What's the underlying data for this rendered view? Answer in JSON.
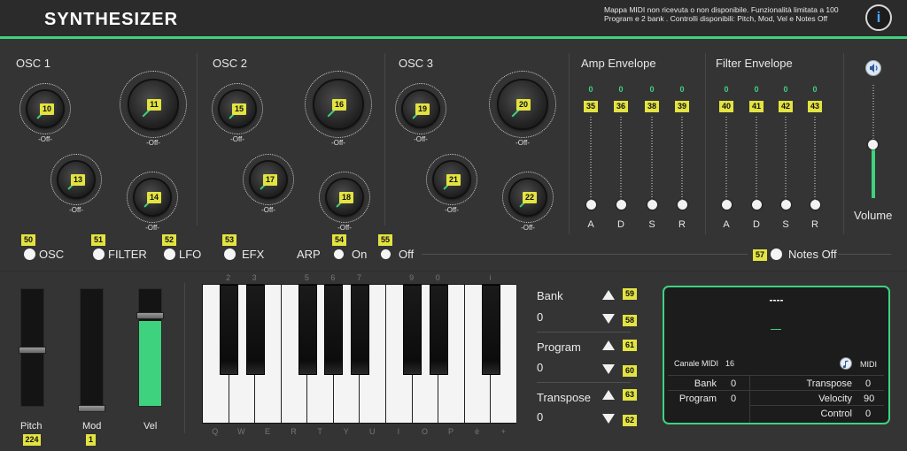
{
  "header": {
    "title": "SYNTHESIZER",
    "notice": "Mappa MIDI non ricevuta  o non disponibile. Funzionalità limitata a 100 Program e 2 bank . Controlli disponibili: Pitch, Mod, Vel e Notes Off",
    "info_label": "i"
  },
  "sections": {
    "osc1": "OSC 1",
    "osc2": "OSC 2",
    "osc3": "OSC 3",
    "amp": "Amp Envelope",
    "filter": "Filter Envelope"
  },
  "knobs": {
    "k10": "10",
    "k11": "11",
    "k13": "13",
    "k14": "14",
    "k15": "15",
    "k16": "16",
    "k17": "17",
    "k18": "18",
    "k19": "19",
    "k20": "20",
    "k21": "21",
    "k22": "22",
    "off": "-Off-"
  },
  "amp_env": {
    "values": [
      "0",
      "0",
      "0",
      "0"
    ],
    "cc": [
      "35",
      "36",
      "38",
      "39"
    ],
    "letters": [
      "A",
      "D",
      "S",
      "R"
    ]
  },
  "filter_env": {
    "values": [
      "0",
      "0",
      "0",
      "0"
    ],
    "cc": [
      "40",
      "41",
      "42",
      "43"
    ],
    "letters": [
      "A",
      "D",
      "S",
      "R"
    ]
  },
  "volume": {
    "label": "Volume",
    "level": 0.47
  },
  "toggles": {
    "cc50": "50",
    "cc51": "51",
    "cc52": "52",
    "cc53": "53",
    "cc54": "54",
    "cc55": "55",
    "cc57": "57",
    "osc": "OSC",
    "filter": "FILTER",
    "lfo": "LFO",
    "efx": "EFX",
    "arp": "ARP",
    "on": "On",
    "off": "Off",
    "notes_off": "Notes Off"
  },
  "wheels": {
    "pitch": "Pitch",
    "mod": "Mod",
    "vel": "Vel",
    "pitch_value": "224",
    "mod_value": "1",
    "vel_level": 0.73
  },
  "keyboard": {
    "top": [
      "2",
      "3",
      "5",
      "6",
      "7",
      "9",
      "0",
      "i"
    ],
    "bottom": [
      "Q",
      "W",
      "E",
      "R",
      "T",
      "Y",
      "U",
      "I",
      "O",
      "P",
      "è",
      "+"
    ]
  },
  "program": {
    "bank_label": "Bank",
    "bank_value": "0",
    "bank_up": "59",
    "bank_down": "58",
    "program_label": "Program",
    "program_value": "0",
    "program_up": "61",
    "program_down": "60",
    "transpose_label": "Transpose",
    "transpose_value": "0",
    "transpose_up": "63",
    "transpose_down": "62"
  },
  "midi": {
    "display": "----",
    "dash": "—",
    "canale_label": "Canale MIDI",
    "canale_value": "16",
    "midi_label": "MIDI",
    "bank_label": "Bank",
    "bank_value": "0",
    "program_label": "Program",
    "program_value": "0",
    "transpose_label": "Transpose",
    "transpose_value": "0",
    "velocity_label": "Velocity",
    "velocity_value": "90",
    "control_label": "Control",
    "control_value": "0"
  },
  "colors": {
    "accent": "#3ed27f",
    "label_bg": "#e3e342",
    "info": "#4fa3ff"
  }
}
